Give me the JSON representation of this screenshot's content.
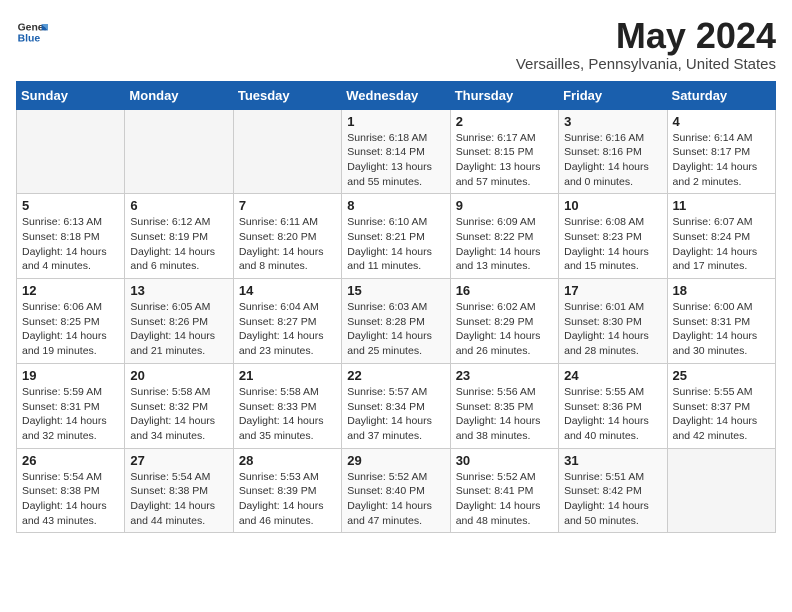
{
  "header": {
    "logo_general": "General",
    "logo_blue": "Blue",
    "month_title": "May 2024",
    "location": "Versailles, Pennsylvania, United States"
  },
  "days_of_week": [
    "Sunday",
    "Monday",
    "Tuesday",
    "Wednesday",
    "Thursday",
    "Friday",
    "Saturday"
  ],
  "weeks": [
    [
      {
        "day": "",
        "info": ""
      },
      {
        "day": "",
        "info": ""
      },
      {
        "day": "",
        "info": ""
      },
      {
        "day": "1",
        "info": "Sunrise: 6:18 AM\nSunset: 8:14 PM\nDaylight: 13 hours\nand 55 minutes."
      },
      {
        "day": "2",
        "info": "Sunrise: 6:17 AM\nSunset: 8:15 PM\nDaylight: 13 hours\nand 57 minutes."
      },
      {
        "day": "3",
        "info": "Sunrise: 6:16 AM\nSunset: 8:16 PM\nDaylight: 14 hours\nand 0 minutes."
      },
      {
        "day": "4",
        "info": "Sunrise: 6:14 AM\nSunset: 8:17 PM\nDaylight: 14 hours\nand 2 minutes."
      }
    ],
    [
      {
        "day": "5",
        "info": "Sunrise: 6:13 AM\nSunset: 8:18 PM\nDaylight: 14 hours\nand 4 minutes."
      },
      {
        "day": "6",
        "info": "Sunrise: 6:12 AM\nSunset: 8:19 PM\nDaylight: 14 hours\nand 6 minutes."
      },
      {
        "day": "7",
        "info": "Sunrise: 6:11 AM\nSunset: 8:20 PM\nDaylight: 14 hours\nand 8 minutes."
      },
      {
        "day": "8",
        "info": "Sunrise: 6:10 AM\nSunset: 8:21 PM\nDaylight: 14 hours\nand 11 minutes."
      },
      {
        "day": "9",
        "info": "Sunrise: 6:09 AM\nSunset: 8:22 PM\nDaylight: 14 hours\nand 13 minutes."
      },
      {
        "day": "10",
        "info": "Sunrise: 6:08 AM\nSunset: 8:23 PM\nDaylight: 14 hours\nand 15 minutes."
      },
      {
        "day": "11",
        "info": "Sunrise: 6:07 AM\nSunset: 8:24 PM\nDaylight: 14 hours\nand 17 minutes."
      }
    ],
    [
      {
        "day": "12",
        "info": "Sunrise: 6:06 AM\nSunset: 8:25 PM\nDaylight: 14 hours\nand 19 minutes."
      },
      {
        "day": "13",
        "info": "Sunrise: 6:05 AM\nSunset: 8:26 PM\nDaylight: 14 hours\nand 21 minutes."
      },
      {
        "day": "14",
        "info": "Sunrise: 6:04 AM\nSunset: 8:27 PM\nDaylight: 14 hours\nand 23 minutes."
      },
      {
        "day": "15",
        "info": "Sunrise: 6:03 AM\nSunset: 8:28 PM\nDaylight: 14 hours\nand 25 minutes."
      },
      {
        "day": "16",
        "info": "Sunrise: 6:02 AM\nSunset: 8:29 PM\nDaylight: 14 hours\nand 26 minutes."
      },
      {
        "day": "17",
        "info": "Sunrise: 6:01 AM\nSunset: 8:30 PM\nDaylight: 14 hours\nand 28 minutes."
      },
      {
        "day": "18",
        "info": "Sunrise: 6:00 AM\nSunset: 8:31 PM\nDaylight: 14 hours\nand 30 minutes."
      }
    ],
    [
      {
        "day": "19",
        "info": "Sunrise: 5:59 AM\nSunset: 8:31 PM\nDaylight: 14 hours\nand 32 minutes."
      },
      {
        "day": "20",
        "info": "Sunrise: 5:58 AM\nSunset: 8:32 PM\nDaylight: 14 hours\nand 34 minutes."
      },
      {
        "day": "21",
        "info": "Sunrise: 5:58 AM\nSunset: 8:33 PM\nDaylight: 14 hours\nand 35 minutes."
      },
      {
        "day": "22",
        "info": "Sunrise: 5:57 AM\nSunset: 8:34 PM\nDaylight: 14 hours\nand 37 minutes."
      },
      {
        "day": "23",
        "info": "Sunrise: 5:56 AM\nSunset: 8:35 PM\nDaylight: 14 hours\nand 38 minutes."
      },
      {
        "day": "24",
        "info": "Sunrise: 5:55 AM\nSunset: 8:36 PM\nDaylight: 14 hours\nand 40 minutes."
      },
      {
        "day": "25",
        "info": "Sunrise: 5:55 AM\nSunset: 8:37 PM\nDaylight: 14 hours\nand 42 minutes."
      }
    ],
    [
      {
        "day": "26",
        "info": "Sunrise: 5:54 AM\nSunset: 8:38 PM\nDaylight: 14 hours\nand 43 minutes."
      },
      {
        "day": "27",
        "info": "Sunrise: 5:54 AM\nSunset: 8:38 PM\nDaylight: 14 hours\nand 44 minutes."
      },
      {
        "day": "28",
        "info": "Sunrise: 5:53 AM\nSunset: 8:39 PM\nDaylight: 14 hours\nand 46 minutes."
      },
      {
        "day": "29",
        "info": "Sunrise: 5:52 AM\nSunset: 8:40 PM\nDaylight: 14 hours\nand 47 minutes."
      },
      {
        "day": "30",
        "info": "Sunrise: 5:52 AM\nSunset: 8:41 PM\nDaylight: 14 hours\nand 48 minutes."
      },
      {
        "day": "31",
        "info": "Sunrise: 5:51 AM\nSunset: 8:42 PM\nDaylight: 14 hours\nand 50 minutes."
      },
      {
        "day": "",
        "info": ""
      }
    ]
  ]
}
